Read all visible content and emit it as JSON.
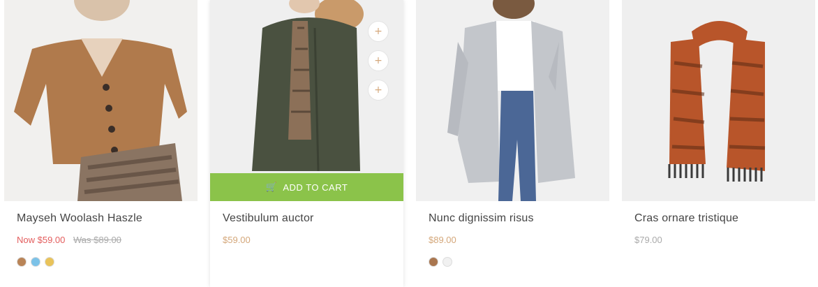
{
  "products": [
    {
      "title": "Mayseh Woolash Haszle",
      "price_now": "Now $59.00",
      "price_was": "Was $89.00",
      "swatch_colors": [
        "#b98457",
        "#7cc2e8",
        "#e9c35a"
      ],
      "image_colors": {
        "garment": "#b07a4c",
        "accent": "#4a3a30"
      }
    },
    {
      "title": "Vestibulum auctor",
      "price": "$59.00",
      "add_to_cart_label": "ADD TO CART",
      "action_icons": [
        "plus-icon",
        "plus-icon",
        "plus-icon"
      ],
      "image_colors": {
        "garment": "#4a5140",
        "accent": "#c99a6a"
      }
    },
    {
      "title": "Nunc dignissim risus",
      "price": "$89.00",
      "swatch_colors": [
        "#a9764f",
        "#f1f1f1"
      ],
      "image_colors": {
        "garment": "#c3c6cb",
        "accent": "#4b6796"
      }
    },
    {
      "title": "Cras ornare tristique",
      "price": "$79.00",
      "image_colors": {
        "garment": "#b8552a",
        "accent": "#3a3a3a"
      }
    }
  ],
  "colors": {
    "sale": "#e35d5d",
    "price": "#d4a77a",
    "add_to_cart_bg": "#8bc34a"
  }
}
